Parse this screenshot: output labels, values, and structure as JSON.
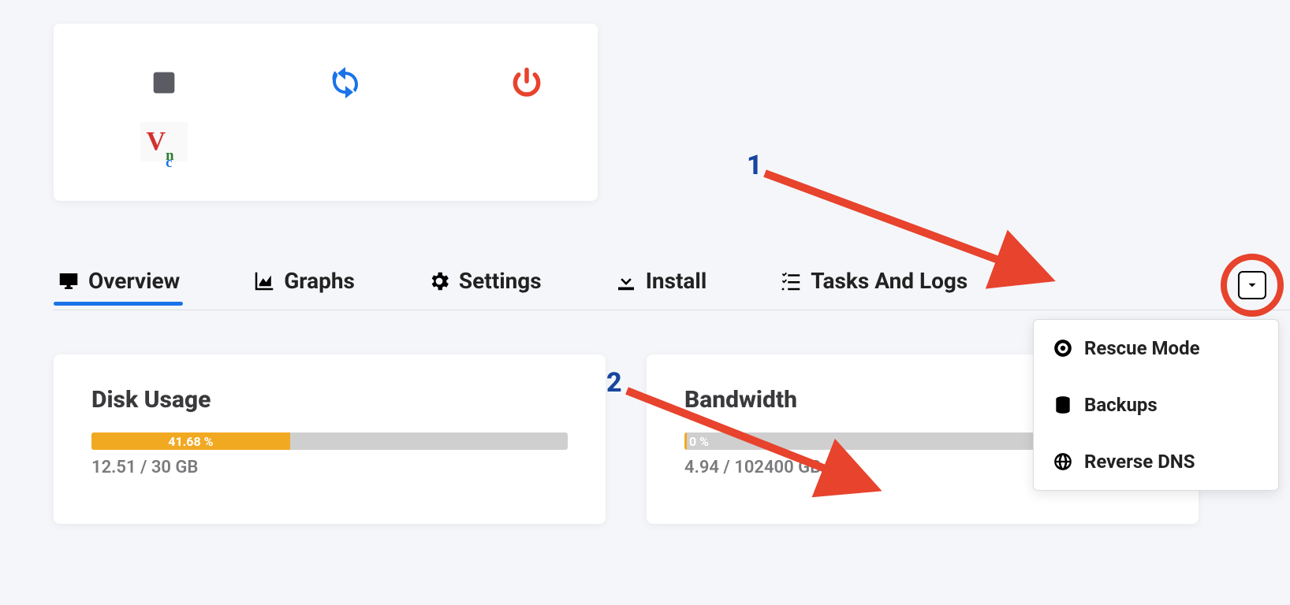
{
  "actions": {
    "stop": "stop",
    "restart": "restart",
    "power": "power",
    "vnc": "Vnc"
  },
  "tabs": {
    "overview": "Overview",
    "graphs": "Graphs",
    "settings": "Settings",
    "install": "Install",
    "tasks": "Tasks And Logs"
  },
  "dropdown": {
    "rescue": "Rescue Mode",
    "backups": "Backups",
    "reverse_dns": "Reverse DNS"
  },
  "metrics": {
    "disk": {
      "title": "Disk Usage",
      "percent_text": "41.68 %",
      "percent": 41.68,
      "sub": "12.51 / 30 GB"
    },
    "bandwidth": {
      "title": "Bandwidth",
      "percent_text": "0 %",
      "percent": 0,
      "sub": "4.94 / 102400 GB"
    }
  },
  "annotations": {
    "one": "1",
    "two": "2"
  },
  "colors": {
    "accent": "#1a73e8",
    "warn": "#f2a922",
    "danger": "#e7432d"
  }
}
